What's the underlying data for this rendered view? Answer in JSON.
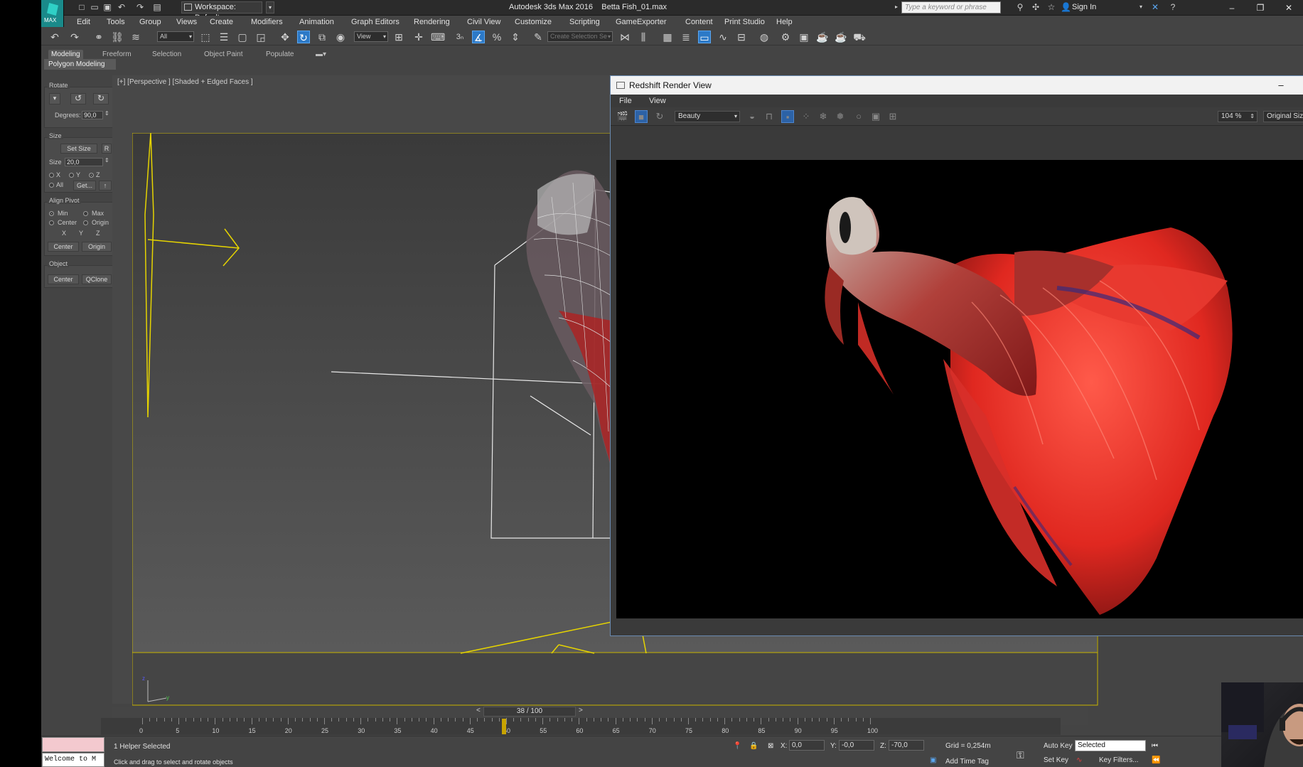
{
  "window": {
    "app_title": "Autodesk 3ds Max 2016",
    "file_name": "Betta Fish_01.max",
    "workspace": "Workspace: Default",
    "search_placeholder": "Type a keyword or phrase",
    "sign_in": "Sign In",
    "logo_text": "MAX"
  },
  "menus": [
    "Edit",
    "Tools",
    "Group",
    "Views",
    "Create",
    "Modifiers",
    "Animation",
    "Graph Editors",
    "Rendering",
    "Civil View",
    "Customize",
    "Scripting",
    "GameExporter",
    "Content",
    "Print Studio",
    "Help"
  ],
  "toolbar": {
    "selection_filter": "All",
    "ref_coord": "View",
    "named_selection": "Create Selection Se",
    "snap_label": "3"
  },
  "ribbon": {
    "tabs": [
      "Modeling",
      "Freeform",
      "Selection",
      "Object Paint",
      "Populate"
    ],
    "active_tab": "Modeling",
    "sub_label": "Polygon Modeling"
  },
  "command_panel": {
    "rotate": {
      "title": "Rotate",
      "degrees_label": "Degrees:",
      "degrees_value": "90,0"
    },
    "size": {
      "title": "Size",
      "set_size": "Set Size",
      "r_button": "R",
      "size_label": "Size",
      "size_value": "20,0",
      "axes": [
        "X",
        "Y",
        "Z"
      ],
      "all_label": "All",
      "get_button": "Get..."
    },
    "align_pivot": {
      "title": "Align Pivot",
      "min": "Min",
      "max": "Max",
      "center": "Center",
      "origin": "Origin",
      "axes": [
        "X",
        "Y",
        "Z"
      ],
      "center_btn": "Center",
      "origin_btn": "Origin"
    },
    "object": {
      "title": "Object",
      "center_btn": "Center",
      "qclone_btn": "QClone"
    }
  },
  "viewport": {
    "label": "[+] [Perspective ] [Shaded + Edged Faces ]"
  },
  "render_view": {
    "title": "Redshift Render View",
    "menus": [
      "File",
      "View"
    ],
    "aov": "Beauty",
    "zoom": "104 %",
    "size_mode": "Original Size"
  },
  "timeline": {
    "frame": "38 / 100",
    "ticks": [
      "0",
      "5",
      "10",
      "15",
      "20",
      "25",
      "30",
      "35",
      "40",
      "45",
      "50",
      "55",
      "60",
      "65",
      "70",
      "75",
      "80",
      "85",
      "90",
      "95",
      "100"
    ]
  },
  "status": {
    "maxscript": "Welcome to M",
    "selection": "1 Helper Selected",
    "prompt": "Click and drag to select and rotate objects",
    "x_label": "X:",
    "x_value": "0,0",
    "y_label": "Y:",
    "y_value": "-0,0",
    "z_label": "Z:",
    "z_value": "-70,0",
    "grid": "Grid = 0,254m",
    "add_time_tag": "Add Time Tag",
    "auto_key": "Auto Key",
    "set_key": "Set Key",
    "key_mode": "Selected",
    "key_filters": "Key Filters..."
  },
  "colors": {
    "accent": "#2c79c7",
    "viewport_border": "#c8b400",
    "helper_color": "#e6d400"
  }
}
